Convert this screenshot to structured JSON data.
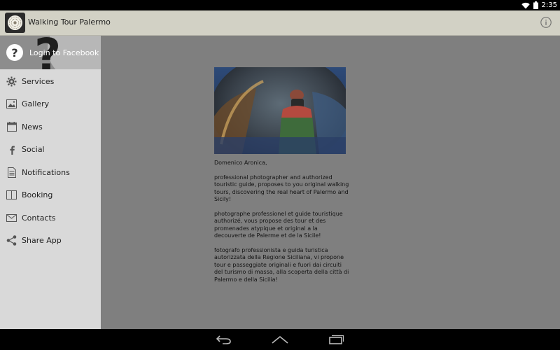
{
  "status_bar": {
    "time": "2:35"
  },
  "app_bar": {
    "title": "Walking Tour Palermo"
  },
  "drawer": {
    "login_label": "Login to Facebook",
    "items": [
      {
        "label": "Services",
        "icon": "gear-icon"
      },
      {
        "label": "Gallery",
        "icon": "image-icon"
      },
      {
        "label": "News",
        "icon": "calendar-icon"
      },
      {
        "label": "Social",
        "icon": "facebook-icon"
      },
      {
        "label": "Notifications",
        "icon": "document-icon"
      },
      {
        "label": "Booking",
        "icon": "book-icon"
      },
      {
        "label": "Contacts",
        "icon": "envelope-icon"
      },
      {
        "label": "Share App",
        "icon": "share-icon"
      }
    ]
  },
  "content": {
    "author": "Domenico Aronica,",
    "paragraph_en": "professional photographer and authorized touristic guide, proposes to you original walking tours, discovering the real heart of Palermo and Sicily!",
    "paragraph_fr": "photographe professionel et guide touristique authorizé, vous propose des tour et des promenades atypique et original a la decouverte de Palerme et de la Sicile!",
    "paragraph_it": "fotografo professionista e guida turistica autorizzata della Regione Siciliana, vi propone tour e passeggiate originali e fuori dai circuiti del turismo di massa, alla scoperta della città di Palermo e della Sicilia!"
  },
  "colors": {
    "app_bar": "#d2d1c5",
    "drawer": "#d9d9d9",
    "scrim": "#7f7f7f"
  }
}
